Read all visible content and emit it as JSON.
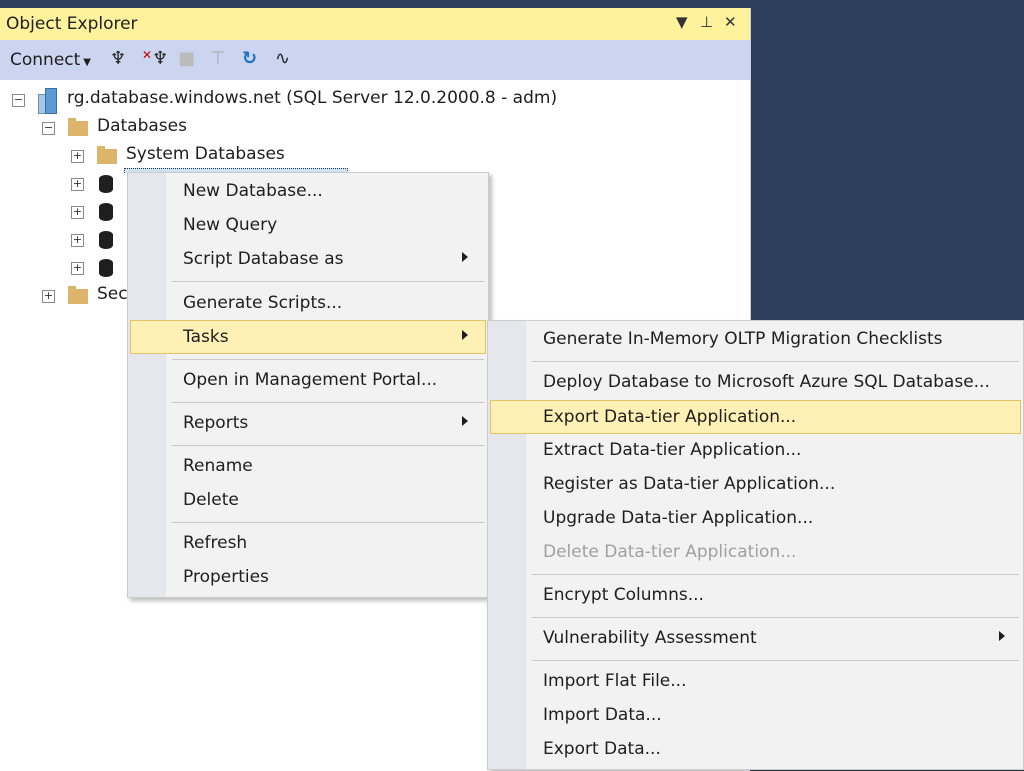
{
  "panel": {
    "title": "Object Explorer",
    "title_controls": [
      "▼",
      "⊥",
      "✕"
    ],
    "toolbar": {
      "connect_label": "Connect",
      "icons": [
        "connect-plug-icon",
        "disconnect-icon",
        "stop-icon",
        "filter-icon",
        "refresh-icon",
        "activity-monitor-icon"
      ]
    }
  },
  "tree": {
    "server": "rg.database.windows.net (SQL Server 12.0.2000.8 - adm)",
    "databases": "Databases",
    "system_databases": "System Databases",
    "security_partial": "Sec"
  },
  "context_menu": {
    "items": [
      {
        "label": "New Database..."
      },
      {
        "label": "New Query"
      },
      {
        "label": "Script Database as"
      },
      {
        "label": "Generate Scripts..."
      },
      {
        "label": "Tasks"
      },
      {
        "label": "Open in Management Portal..."
      },
      {
        "label": "Reports"
      },
      {
        "label": "Rename"
      },
      {
        "label": "Delete"
      },
      {
        "label": "Refresh"
      },
      {
        "label": "Properties"
      }
    ]
  },
  "tasks_menu": {
    "items": [
      {
        "label": "Generate In-Memory OLTP Migration Checklists"
      },
      {
        "label": "Deploy Database to Microsoft Azure SQL Database..."
      },
      {
        "label": "Export Data-tier Application..."
      },
      {
        "label": "Extract Data-tier Application..."
      },
      {
        "label": "Register as Data-tier Application..."
      },
      {
        "label": "Upgrade Data-tier Application..."
      },
      {
        "label": "Delete Data-tier Application..."
      },
      {
        "label": "Encrypt Columns..."
      },
      {
        "label": "Vulnerability Assessment"
      },
      {
        "label": "Import Flat File..."
      },
      {
        "label": "Import Data..."
      },
      {
        "label": "Export Data..."
      }
    ]
  },
  "colors": {
    "title_bar": "#fff29d",
    "toolbar": "#ccd5f0",
    "highlight": "#fff0b5",
    "background_dark": "#2d3e5c"
  }
}
